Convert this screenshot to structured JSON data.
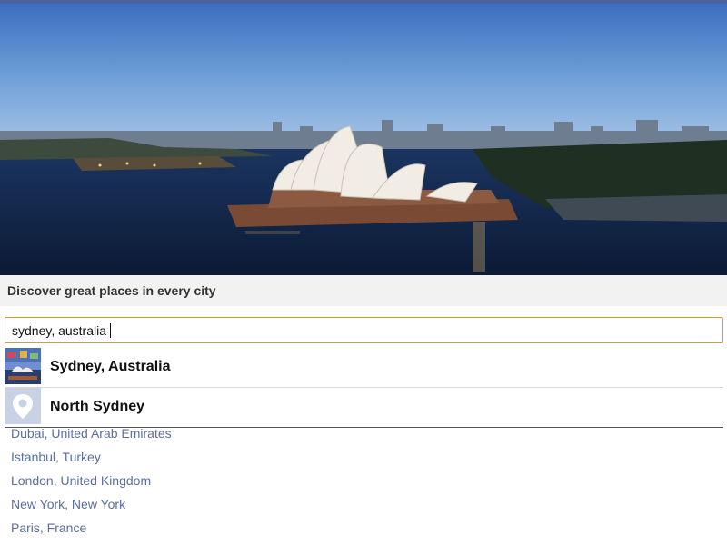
{
  "hero": {
    "image": "sydney-opera-house-harbour-photo"
  },
  "tagline": "Discover great places in every city",
  "search": {
    "value": "sydney, australia",
    "border_color": "#e09a2b"
  },
  "suggestions": [
    {
      "label": "Sydney, Australia",
      "icon": "city-thumbnail"
    },
    {
      "label": "North Sydney",
      "icon": "map-pin-icon"
    }
  ],
  "cities": [
    {
      "label": "Dubai, United Arab Emirates"
    },
    {
      "label": "Istanbul, Turkey"
    },
    {
      "label": "London, United Kingdom"
    },
    {
      "label": "New York, New York"
    },
    {
      "label": "Paris, France"
    }
  ],
  "colors": {
    "link": "#5a6fa0",
    "topbar": "#4b63a3"
  }
}
